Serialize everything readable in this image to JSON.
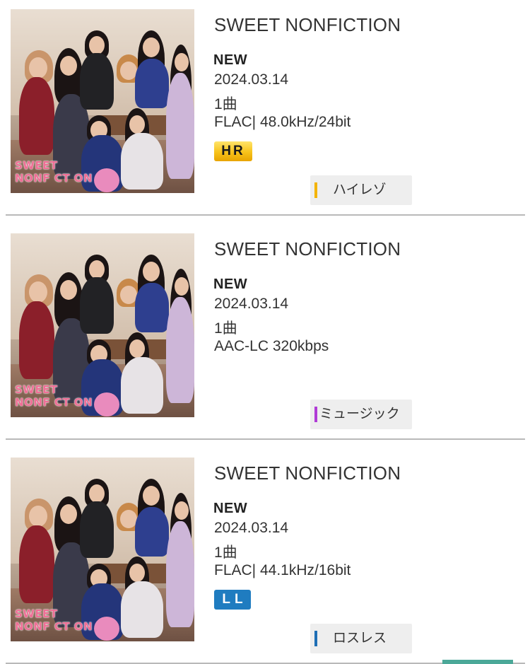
{
  "items": [
    {
      "cover_text_1": "SWEET",
      "cover_text_2": "NONF  CT ON",
      "title": "SWEET NONFICTION",
      "new_label": "NEW",
      "date": "2024.03.14",
      "tracks": "1曲",
      "format": "FLAC| 48.0kHz/24bit",
      "badge": "HR",
      "category": "ハイレゾ",
      "category_color": "#f4b400"
    },
    {
      "cover_text_1": "SWEET",
      "cover_text_2": "NONF  CT ON",
      "title": "SWEET NONFICTION",
      "new_label": "NEW",
      "date": "2024.03.14",
      "tracks": "1曲",
      "format": "AAC-LC 320kbps",
      "category": "ミュージック",
      "category_color": "#b03bd6"
    },
    {
      "cover_text_1": "SWEET",
      "cover_text_2": "NONF  CT ON",
      "title": "SWEET NONFICTION",
      "new_label": "NEW",
      "date": "2024.03.14",
      "tracks": "1曲",
      "format": "FLAC| 44.1kHz/16bit",
      "badge": "LL",
      "category": "ロスレス",
      "category_color": "#1f6fb5"
    }
  ],
  "colors": {
    "hr_badge": "#f7c21a",
    "ll_badge": "#1f7cc0",
    "divider": "#b9b9b9",
    "category_bg": "#eeeeee",
    "corner_tab": "#4ba898"
  }
}
